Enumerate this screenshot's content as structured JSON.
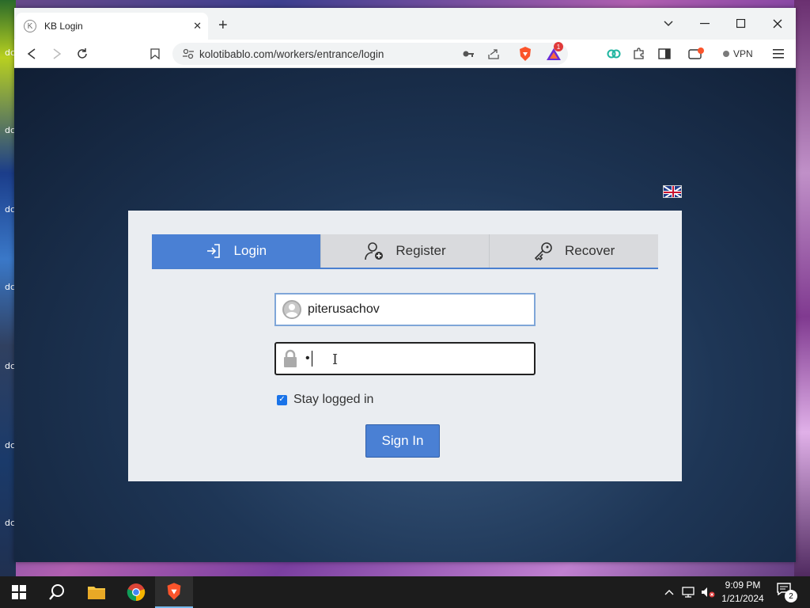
{
  "desktop": {
    "icon_labels": [
      "dc",
      "dc",
      "dc",
      "dc",
      "dc",
      "dc",
      "dc"
    ]
  },
  "browser": {
    "tab": {
      "title": "KB Login",
      "favicon_letter": "K"
    },
    "url": "kolotibablo.com/workers/entrance/login",
    "vpn_label": "VPN",
    "extension_badge": "1"
  },
  "page": {
    "language_flag": "uk-flag",
    "tabs": [
      {
        "label": "Login",
        "icon": "login-icon",
        "active": true
      },
      {
        "label": "Register",
        "icon": "add-user-icon",
        "active": false
      },
      {
        "label": "Recover",
        "icon": "key-icon",
        "active": false
      }
    ],
    "username_value": "piterusachov",
    "password_masked": "•",
    "stay_logged_in_label": "Stay logged in",
    "stay_logged_in_checked": true,
    "signin_label": "Sign In"
  },
  "taskbar": {
    "time": "9:09 PM",
    "date": "1/21/2024",
    "notification_count": "2"
  },
  "colors": {
    "accent": "#4a80d4",
    "panel_bg": "#eaedf1",
    "page_bg": "#1e3656"
  }
}
